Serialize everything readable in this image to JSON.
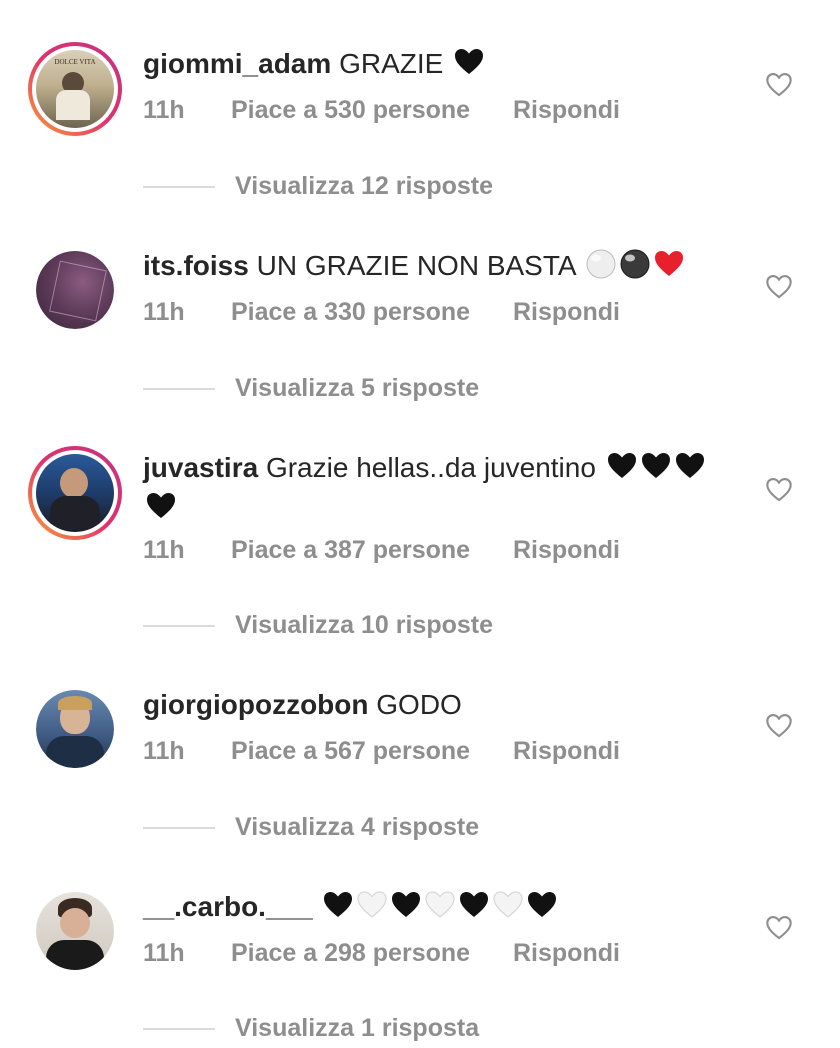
{
  "comments": [
    {
      "username": "giommi_adam",
      "text": "GRAZIE",
      "emoji": [
        "black-heart"
      ],
      "time": "11h",
      "likes": "Piace a 530 persone",
      "reply": "Rispondi",
      "replies": "Visualizza 12 risposte",
      "avatar_title": "DOLCE VITA"
    },
    {
      "username": "its.foiss",
      "text": "UN GRAZIE NON BASTA",
      "emoji": [
        "white-circle",
        "black-circle",
        "red-heart"
      ],
      "time": "11h",
      "likes": "Piace a 330 persone",
      "reply": "Rispondi",
      "replies": "Visualizza 5 risposte"
    },
    {
      "username": "juvastira",
      "text": "Grazie hellas..da juventino",
      "emoji": [
        "black-heart",
        "black-heart",
        "black-heart",
        "black-heart"
      ],
      "time": "11h",
      "likes": "Piace a 387 persone",
      "reply": "Rispondi",
      "replies": "Visualizza 10 risposte"
    },
    {
      "username": "giorgiopozzobon",
      "text": "GODO",
      "emoji": [],
      "time": "11h",
      "likes": "Piace a 567 persone",
      "reply": "Rispondi",
      "replies": "Visualizza 4 risposte"
    },
    {
      "username": "__.carbo.___",
      "text": "",
      "emoji": [
        "black-heart",
        "white-heart",
        "black-heart",
        "white-heart",
        "black-heart",
        "white-heart",
        "black-heart"
      ],
      "time": "11h",
      "likes": "Piace a 298 persone",
      "reply": "Rispondi",
      "replies": "Visualizza 1 risposta"
    }
  ],
  "icons": {
    "like": "heart-outline-icon"
  },
  "colors": {
    "secondary_text": "#8e8e8e",
    "primary_text": "#262626",
    "story_ring": "#e1306c"
  }
}
